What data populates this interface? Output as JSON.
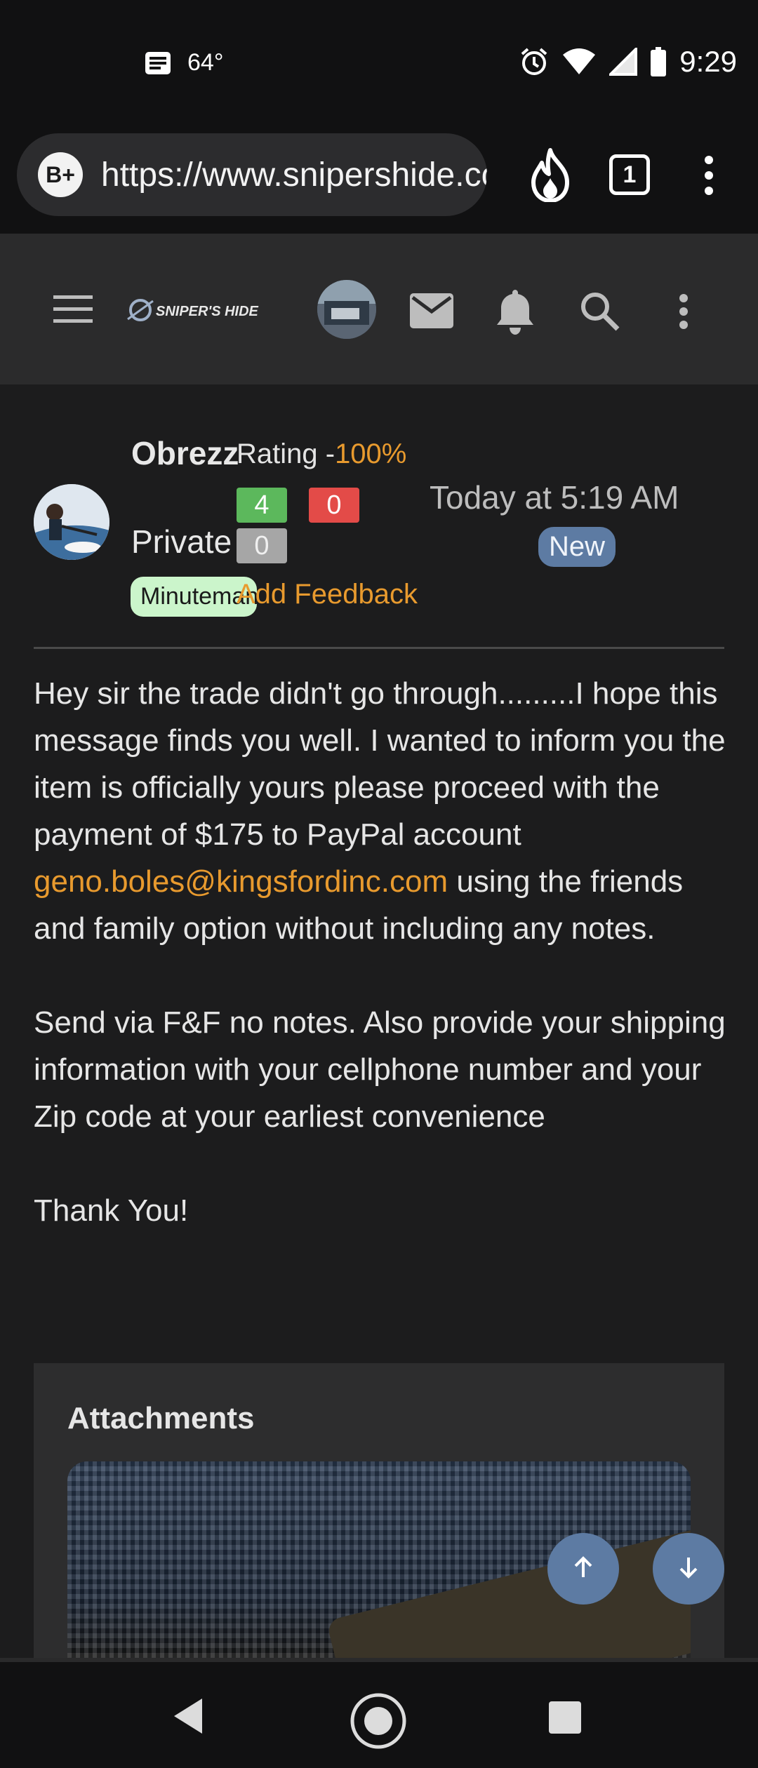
{
  "status_bar": {
    "temperature": "64°",
    "time": "9:29"
  },
  "browser": {
    "brave_label": "B+",
    "url": "https://www.snipershide.com/shooting/threads/",
    "tab_count": "1"
  },
  "site_header": {
    "logo_text": "SNIPER'S HIDE"
  },
  "post": {
    "username": "Obrezz",
    "user_title": "Private",
    "banner": "Minuteman",
    "rating_label": "Rating -",
    "rating_pct": "100%",
    "feedback_positive": "4",
    "feedback_negative": "0",
    "feedback_neutral": "0",
    "add_feedback": "Add Feedback",
    "date": "Today at 5:19 AM",
    "new_badge": "New",
    "body_p1_before": "Hey sir the trade didn't go through.........I hope this message finds you well. I wanted to inform you the item is officially yours please proceed with the payment of $175 to PayPal account ",
    "email": "geno.boles@kingsfordinc.com",
    "body_p1_after": " using the friends and family option without including any notes.",
    "body_p2": "Send via F&F no notes. Also provide your shipping information with your cellphone number and your Zip code at your earliest convenience",
    "body_p3": "Thank You!",
    "attachments_title": "Attachments"
  },
  "colors": {
    "accent_orange": "#e89a2e",
    "badge_blue": "#5d7ba3",
    "positive_green": "#5cb85c",
    "negative_red": "#e34b48"
  }
}
